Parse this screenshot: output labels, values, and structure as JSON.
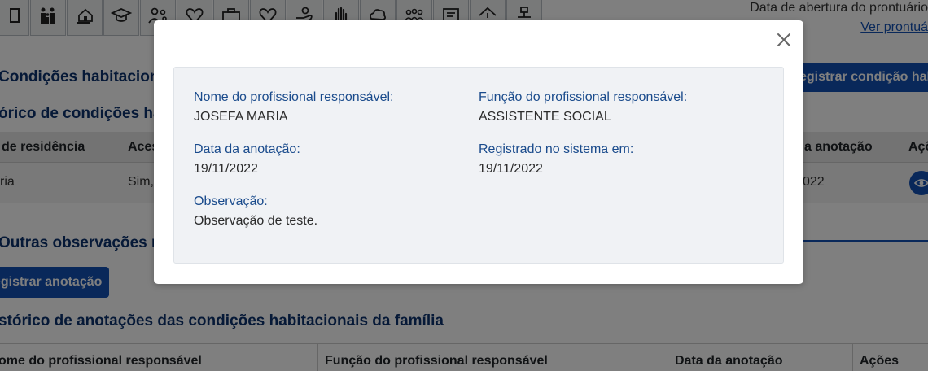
{
  "header": {
    "open_date_label": "Data de abertura do prontuário",
    "view_link": "Ver prontuá"
  },
  "icon_tabs": [
    {
      "name": "rectangle-icon"
    },
    {
      "name": "family-icon"
    },
    {
      "name": "house-hand-icon"
    },
    {
      "name": "graduation-cap-icon"
    },
    {
      "name": "person-gears-icon"
    },
    {
      "name": "heart-icon"
    },
    {
      "name": "briefcase-icon"
    },
    {
      "name": "heart-outline-icon"
    },
    {
      "name": "hand-coin-icon"
    },
    {
      "name": "raised-hand-icon"
    },
    {
      "name": "cloud-warning-icon"
    },
    {
      "name": "group-icon"
    },
    {
      "name": "form-icon"
    },
    {
      "name": "house-warning-icon"
    },
    {
      "name": "network-icon"
    }
  ],
  "background": {
    "section_title": "Condições habitacion",
    "register_condition_button": "egistrar condição hab",
    "history_title": "órico de condições ha",
    "table1_headers": {
      "col1": "de residência",
      "col2": "Aces",
      "col3": "a anotação",
      "col4": "Açõ"
    },
    "table1_row": {
      "col1": "ria",
      "col2": "Sim,",
      "col3": "022"
    },
    "other_obs_title": "Outras observações re",
    "register_note_button": "egistrar anotação",
    "notes_history_title": "stórico de anotações das condições habitacionais da família",
    "table2_headers": {
      "col1": "ome do profissional responsável",
      "col2": "Função do profissional responsável",
      "col3": "Data da anotação",
      "col4": "Ações"
    }
  },
  "modal": {
    "professional_name_label": "Nome do profissional responsável:",
    "professional_name_value": "JOSEFA MARIA",
    "professional_role_label": "Função do profissional responsável:",
    "professional_role_value": "ASSISTENTE SOCIAL",
    "note_date_label": "Data da anotação:",
    "note_date_value": "19/11/2022",
    "registered_label": "Registrado no sistema em:",
    "registered_value": "19/11/2022",
    "observation_label": "Observação:",
    "observation_value": "Observação de teste."
  }
}
